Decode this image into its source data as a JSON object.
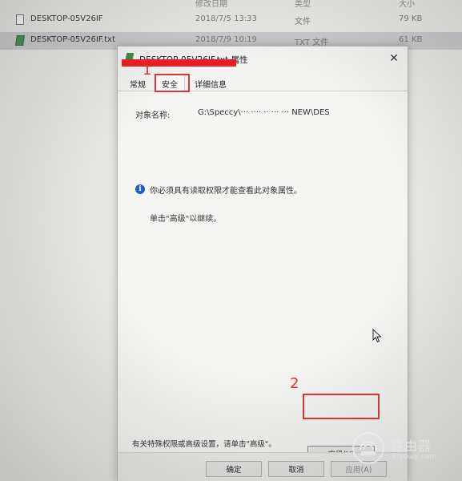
{
  "explorer": {
    "headers": {
      "date": "修改日期",
      "type": "类型",
      "size": "大小"
    },
    "rows": [
      {
        "name": "DESKTOP-05V26IF",
        "date": "2018/7/5 13:33",
        "type": "文件",
        "size": "79 KB"
      },
      {
        "name": "DESKTOP-05V26IF.txt",
        "date": "2018/7/9 10:19",
        "type": "TXT 文件",
        "size": "61 KB"
      }
    ]
  },
  "dialog": {
    "title": "DESKTOP-05V26IF.txt 属性",
    "close_glyph": "✕",
    "tabs": [
      "常规",
      "安全",
      "详细信息"
    ],
    "object_label": "对象名称:",
    "object_value": "G:\\Speccy\\··· ···· ·· ··· ··· NEW\\DES",
    "info_icon_glyph": "i",
    "info_text": "你必须具有读取权限才能查看此对象属性。",
    "continue_text": "单击\"高级\"以继续。",
    "advanced_note": "有关特殊权限或高级设置，请单击\"高级\"。",
    "advanced_button": "高级(V)",
    "buttons": {
      "ok": "确定",
      "cancel": "取消",
      "apply": "应用(A)"
    }
  },
  "annotations": {
    "step1": "1",
    "step2": "2",
    "color": "#e8322f"
  },
  "redaction_color": "#ee1c24",
  "watermark": {
    "cn": "路由器",
    "en": "luyouqi.com"
  }
}
